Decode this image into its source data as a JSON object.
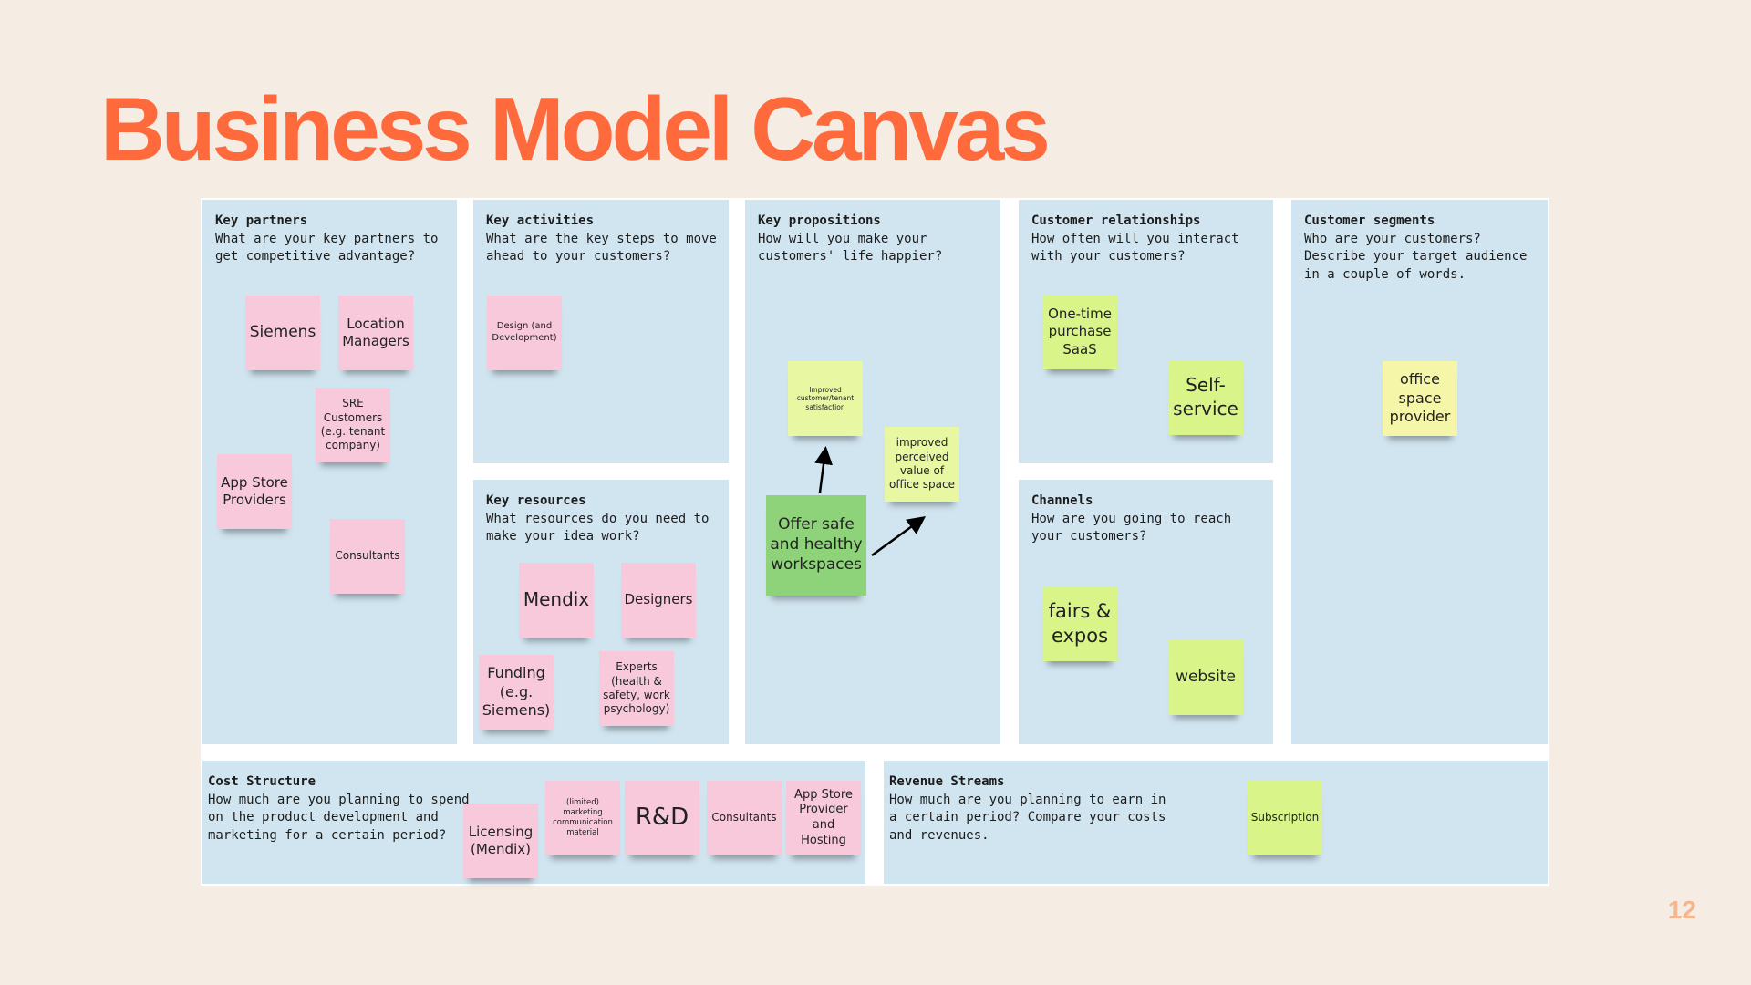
{
  "title": "Business Model Canvas",
  "page_number": "12",
  "colors": {
    "title": "#FF6A3D",
    "cell": "#D1E5F0",
    "background": "#F5EDE3",
    "pink_note": "#F7C9DA",
    "green_note": "#D9F58A",
    "dark_green_note": "#8ED27A"
  },
  "sections": {
    "key_partners": {
      "title": "Key partners",
      "question": "What are your key partners to get competitive advantage?",
      "notes": [
        "Siemens",
        "Location Managers",
        "SRE Customers (e.g. tenant company)",
        "App Store Providers",
        "Consultants"
      ]
    },
    "key_activities": {
      "title": "Key activities",
      "question": "What are the key steps to move ahead to your customers?",
      "notes": [
        "Design (and Development)"
      ]
    },
    "key_resources": {
      "title": "Key resources",
      "question": "What resources do you need to make your idea work?",
      "notes": [
        "Mendix",
        "Designers",
        "Funding (e.g. Siemens)",
        "Experts (health & safety, work psychology)"
      ]
    },
    "key_propositions": {
      "title": "Key propositions",
      "question": "How will you make your customers' life happier?",
      "notes": [
        "Improved customer/tenant satisfaction",
        "improved perceived value of office space",
        "Offer safe and healthy workspaces"
      ]
    },
    "customer_relationships": {
      "title": "Customer relationships",
      "question": "How often will you interact with your customers?",
      "notes": [
        "One-time purchase SaaS",
        "Self-service"
      ]
    },
    "channels": {
      "title": "Channels",
      "question": "How are you going to reach your customers?",
      "notes": [
        "fairs & expos",
        "website"
      ]
    },
    "customer_segments": {
      "title": "Customer segments",
      "question": "Who are your customers? Describe your target audience in a couple of words.",
      "notes": [
        "office space provider"
      ]
    },
    "cost_structure": {
      "title": "Cost Structure",
      "question": "How much are you planning to spend on the product development and marketing for a certain period?",
      "notes": [
        "Licensing (Mendix)",
        "(limited) marketing communication material",
        "R&D",
        "Consultants",
        "App Store Provider and Hosting"
      ]
    },
    "revenue_streams": {
      "title": "Revenue Streams",
      "question": "How much are you planning to earn in a certain period? Compare your costs and revenues.",
      "notes": [
        "Subscription"
      ]
    }
  }
}
